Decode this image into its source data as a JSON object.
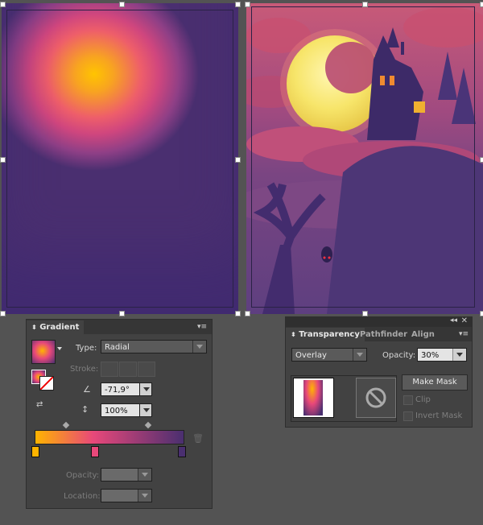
{
  "gradient_panel": {
    "tab_label": "Gradient",
    "type_label": "Type:",
    "type_value": "Radial",
    "stroke_label": "Stroke:",
    "angle_value": "-71,9°",
    "aspect_value": "100%",
    "opacity_label": "Opacity:",
    "location_label": "Location:",
    "stops": [
      {
        "color": "#ffb400",
        "location": 0
      },
      {
        "color": "#e8487a",
        "location": 0.39
      },
      {
        "color": "#4a2f70",
        "location": 1
      }
    ]
  },
  "transparency_panel": {
    "tabs": [
      "Transparency",
      "Pathfinder",
      "Align"
    ],
    "blend_mode": "Overlay",
    "opacity_label": "Opacity:",
    "opacity_value": "30%",
    "make_mask_label": "Make Mask",
    "clip_label": "Clip",
    "invert_mask_label": "Invert Mask"
  },
  "colors": {
    "panel_bg": "#424242",
    "workspace_bg": "#535353",
    "gradient_start": "#ffb400",
    "gradient_mid": "#e8487a",
    "gradient_end": "#4a2f70"
  }
}
